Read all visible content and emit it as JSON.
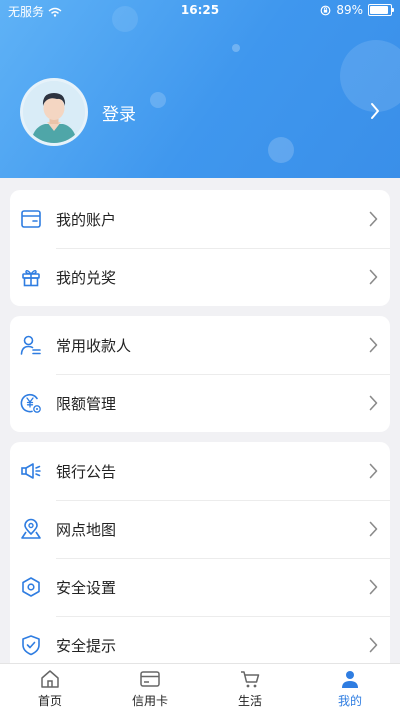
{
  "status_bar": {
    "carrier": "无服务",
    "time": "16:25",
    "battery_percent": "89%",
    "battery_level": 0.89,
    "icons": [
      "wifi-icon",
      "orientation-lock-icon",
      "battery-icon"
    ]
  },
  "profile": {
    "login_label": "登录",
    "avatar_icon": "user-avatar-icon",
    "arrow_icon": "chevron-right-icon"
  },
  "groups": [
    {
      "items": [
        {
          "label": "我的账户",
          "icon": "wallet-icon"
        },
        {
          "label": "我的兑奖",
          "icon": "gift-icon"
        }
      ]
    },
    {
      "items": [
        {
          "label": "常用收款人",
          "icon": "payee-icon"
        },
        {
          "label": "限额管理",
          "icon": "limit-yen-icon"
        }
      ]
    },
    {
      "items": [
        {
          "label": "银行公告",
          "icon": "megaphone-icon"
        },
        {
          "label": "网点地图",
          "icon": "map-pin-icon"
        },
        {
          "label": "安全设置",
          "icon": "hexagon-settings-icon"
        },
        {
          "label": "安全提示",
          "icon": "shield-check-icon"
        }
      ]
    }
  ],
  "tabbar": {
    "tabs": [
      {
        "label": "首页",
        "icon": "home-icon",
        "active": false
      },
      {
        "label": "信用卡",
        "icon": "credit-card-icon",
        "active": false
      },
      {
        "label": "生活",
        "icon": "cart-icon",
        "active": false
      },
      {
        "label": "我的",
        "icon": "person-icon",
        "active": true
      }
    ]
  },
  "colors": {
    "accent": "#2f7de1",
    "header_gradient_start": "#5fb2f6",
    "header_gradient_end": "#3a8fe9",
    "background": "#f1f1f4"
  }
}
